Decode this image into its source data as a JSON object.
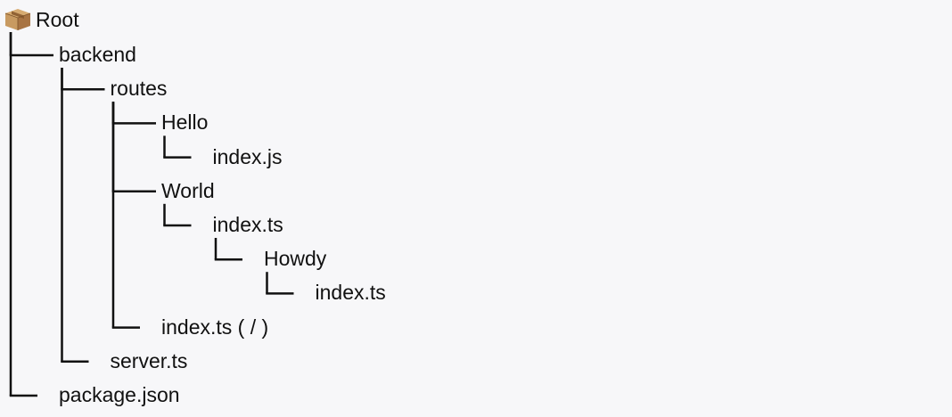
{
  "tree": {
    "root": {
      "label": "Root",
      "icon": "package-icon"
    },
    "nodes": [
      {
        "label": "backend",
        "depth": 1,
        "last": false
      },
      {
        "label": "routes",
        "depth": 2,
        "last": false
      },
      {
        "label": "Hello",
        "depth": 3,
        "last": false
      },
      {
        "label": "index.js",
        "depth": 4,
        "last": true
      },
      {
        "label": "World",
        "depth": 3,
        "last": false
      },
      {
        "label": "index.ts",
        "depth": 4,
        "last": true
      },
      {
        "label": "Howdy",
        "depth": 5,
        "last": true
      },
      {
        "label": "index.ts",
        "depth": 6,
        "last": true
      },
      {
        "label": "index.ts ( / )",
        "depth": 3,
        "last": true
      },
      {
        "label": "server.ts",
        "depth": 2,
        "last": true
      },
      {
        "label": "package.json",
        "depth": 1,
        "last": true
      }
    ],
    "colors": {
      "background": "#f7f7f9",
      "text": "#111111",
      "lines": "#111111",
      "box_top": "#c89a61",
      "box_side": "#a87443",
      "box_tape": "#8a5a2e"
    }
  }
}
